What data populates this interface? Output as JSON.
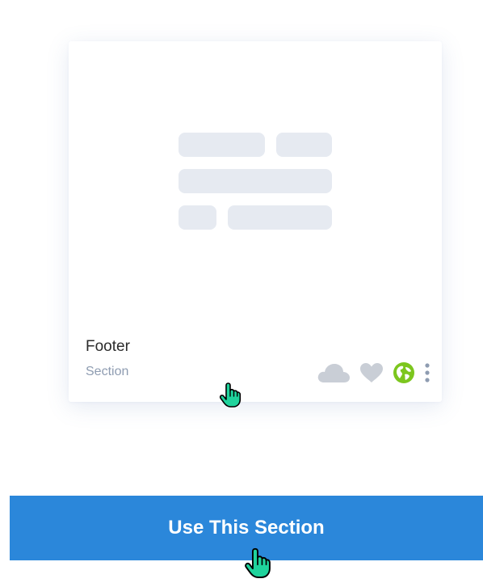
{
  "card": {
    "title": "Footer",
    "subtitle": "Section",
    "icons": [
      "cloud-icon",
      "heart-icon",
      "globe-icon",
      "more-vertical-icon"
    ]
  },
  "cta": {
    "label": "Use This Section"
  },
  "colors": {
    "accent": "#2b87da",
    "globe": "#7cc61e",
    "muted_icon": "#c9ced6",
    "subtitle": "#8e9cb1",
    "placeholder": "#e6eaf1",
    "cursor": "#1fd39c"
  }
}
